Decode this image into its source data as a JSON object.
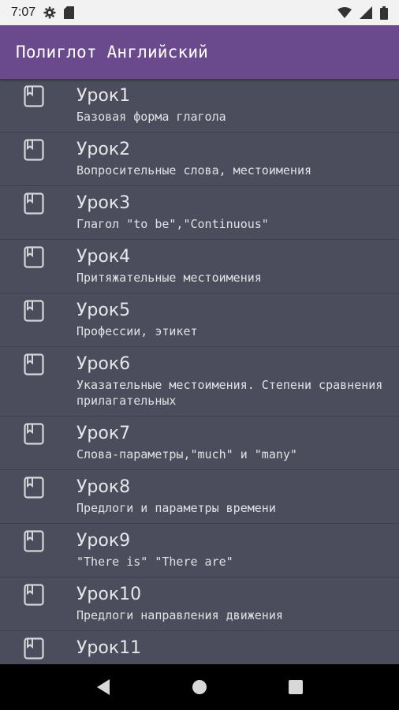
{
  "status_bar": {
    "time": "7:07",
    "icons": [
      "gear-icon",
      "sd-card-icon",
      "wifi-icon",
      "signal-icon",
      "battery-icon"
    ]
  },
  "app_bar": {
    "title": "Полиглот Английский",
    "color": "#6a4a8c"
  },
  "lessons": [
    {
      "title": "Урок1",
      "subtitle": "Базовая форма глагола",
      "icon": "book-icon"
    },
    {
      "title": "Урок2",
      "subtitle": "Вопросительные слова, местоимения",
      "icon": "book-icon"
    },
    {
      "title": "Урок3",
      "subtitle": "Глагол \"to be\",\"Continuous\"",
      "icon": "book-icon"
    },
    {
      "title": "Урок4",
      "subtitle": "Притяжательные местоимения",
      "icon": "book-icon"
    },
    {
      "title": "Урок5",
      "subtitle": "Профессии, этикет",
      "icon": "book-icon"
    },
    {
      "title": "Урок6",
      "subtitle": "Указательные местоимения. Степени сравнения прилагательных",
      "icon": "book-icon"
    },
    {
      "title": "Урок7",
      "subtitle": "Слова-параметры,\"much\" и \"many\"",
      "icon": "book-icon"
    },
    {
      "title": "Урок8",
      "subtitle": "Предлоги и параметры времени",
      "icon": "book-icon"
    },
    {
      "title": "Урок9",
      "subtitle": "\"There is\" \"There are\"",
      "icon": "book-icon"
    },
    {
      "title": "Урок10",
      "subtitle": "Предлоги направления движения",
      "icon": "book-icon"
    },
    {
      "title": "Урок11",
      "subtitle": "",
      "icon": "book-icon"
    }
  ],
  "nav_bar": {
    "buttons": [
      "back-icon",
      "home-icon",
      "recents-icon"
    ]
  }
}
